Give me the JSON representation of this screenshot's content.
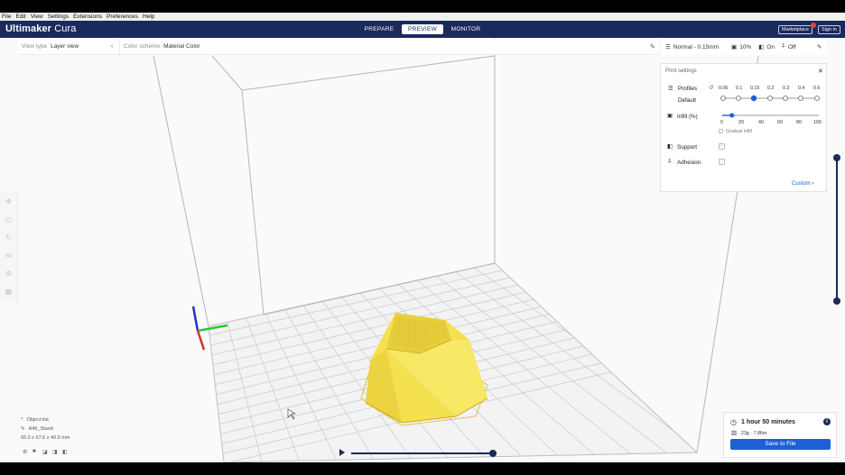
{
  "menu": [
    "File",
    "Edit",
    "View",
    "Settings",
    "Extensions",
    "Preferences",
    "Help"
  ],
  "header": {
    "logo_bold": "Ultimaker",
    "logo_light": " Cura",
    "tabs": [
      {
        "label": "PREPARE"
      },
      {
        "label": "PREVIEW"
      },
      {
        "label": "MONITOR"
      }
    ],
    "active_tab": "PREVIEW",
    "marketplace": "Marketplace",
    "signin": "Sign in"
  },
  "viewbar": {
    "view_type_label": "View type",
    "view_type_value": "Layer view",
    "color_scheme_label": "Color scheme",
    "color_scheme_value": "Material Color"
  },
  "settings_summary": {
    "profile": "Normal - 0.15mm",
    "infill": "10%",
    "support": "On",
    "adhesion": "Off"
  },
  "print_settings": {
    "title": "Print settings",
    "profiles_label": "Profiles",
    "default_label": "Default",
    "layer_heights": [
      "0.06",
      "0.1",
      "0.15",
      "0.2",
      "0.3",
      "0.4",
      "0.6"
    ],
    "selected_layer_height": "0.15",
    "infill_label": "Infill (%)",
    "infill_ticks": [
      "0",
      "20",
      "40",
      "60",
      "80",
      "100"
    ],
    "infill_value": 10,
    "gradual_infill": "Gradual infill",
    "support_label": "Support",
    "support_checked": true,
    "adhesion_label": "Adhesion",
    "adhesion_checked": false,
    "custom_button": "Custom"
  },
  "object_info": {
    "list_label": "Object list",
    "object_name": "A46_Stand",
    "dimensions": "65.0 x 67.6 x 40.0 mm"
  },
  "action_panel": {
    "print_time": "1 hour 50 minutes",
    "material": "23g · 7.86m",
    "save_button": "Save to File"
  },
  "colors": {
    "header": "#1a2a5a",
    "accent": "#1e5fd6",
    "model": "#f5e050"
  }
}
